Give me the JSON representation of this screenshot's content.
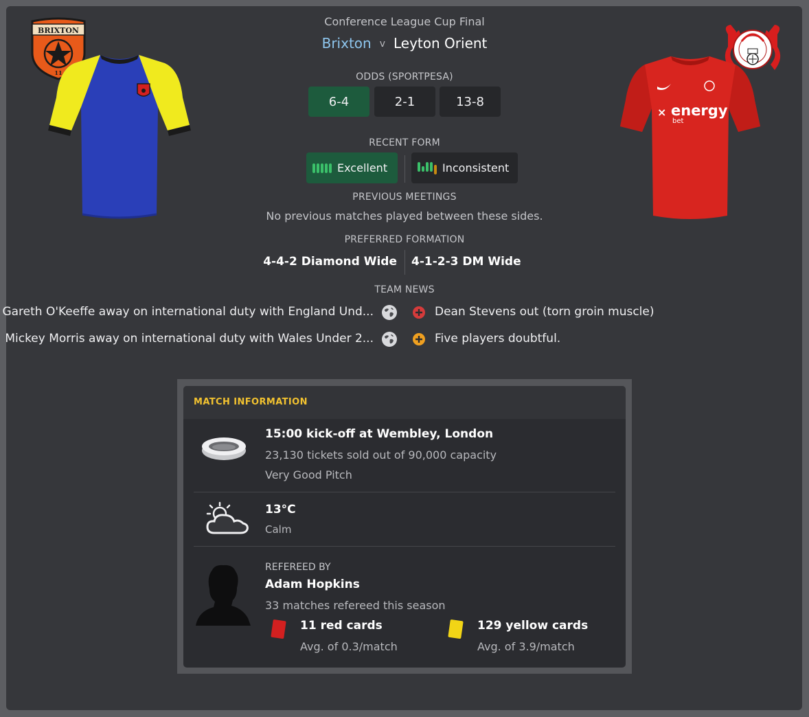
{
  "header": {
    "competition": "Conference League Cup Final",
    "home_team": "Brixton",
    "versus": "v",
    "away_team": "Leyton Orient"
  },
  "badges": {
    "home_badge_text_top": "BRIXTON",
    "home_badge_text_bottom": "11"
  },
  "kits": {
    "away_sponsor": "energy",
    "away_sponsor_sub": "bet"
  },
  "odds": {
    "label": "ODDS (SPORTPESA)",
    "values": [
      "6-4",
      "2-1",
      "13-8"
    ]
  },
  "recent_form": {
    "label": "RECENT FORM",
    "home": "Excellent",
    "away": "Inconsistent"
  },
  "previous_meetings": {
    "label": "PREVIOUS MEETINGS",
    "text": "No previous matches played between these sides."
  },
  "preferred_formation": {
    "label": "PREFERRED FORMATION",
    "home": "4-4-2 Diamond Wide",
    "away": "4-1-2-3 DM Wide"
  },
  "team_news": {
    "label": "TEAM NEWS",
    "home": [
      "Gareth O'Keeffe away on international duty with England Und...",
      "Mickey Morris away on international duty with Wales Under 2..."
    ],
    "away": [
      "Dean Stevens out (torn groin muscle)",
      "Five players doubtful."
    ]
  },
  "match_information": {
    "title": "MATCH INFORMATION",
    "venue": {
      "headline": "15:00 kick-off at Wembley, London",
      "tickets": "23,130 tickets sold out of 90,000 capacity",
      "pitch": "Very Good Pitch"
    },
    "weather": {
      "temperature": "13°C",
      "wind": "Calm"
    },
    "referee": {
      "label": "REFEREED BY",
      "name": "Adam Hopkins",
      "matches": "33 matches refereed this season",
      "red_cards": "11 red cards",
      "red_avg": "Avg. of 0.3/match",
      "yellow_cards": "129 yellow cards",
      "yellow_avg": "Avg. of 3.9/match"
    }
  },
  "colors": {
    "accent_title": "#f2c230",
    "home_name": "#8ec6ee",
    "favourite_green": "#1d5b3d",
    "form_green": "#3bc06a",
    "form_amber": "#c88a12",
    "injury_red": "#d63b3b",
    "doubt_orange": "#f0a020"
  }
}
